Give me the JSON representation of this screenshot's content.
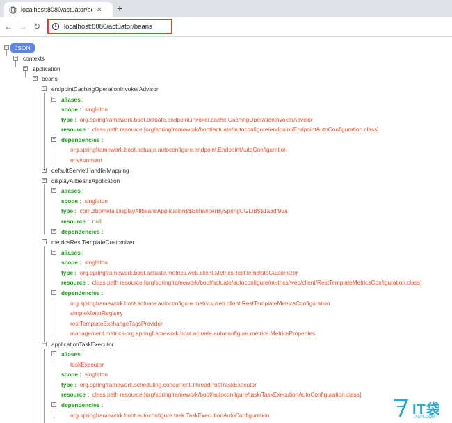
{
  "browser": {
    "tab_title": "localhost:8080/actuator/bean",
    "url": "localhost:8080/actuator/beans"
  },
  "tree": {
    "root": "JSON",
    "contexts": "contexts",
    "application": "application",
    "beans": "beans",
    "labels": {
      "aliases": "aliases :",
      "scope": "scope :",
      "type": "type :",
      "resource": "resource :",
      "dependencies": "dependencies :"
    },
    "bean_list": [
      {
        "name": "endpointCachingOperationInvokerAdvisor",
        "scope": "singleton",
        "type": "org.springframework.boot.actuate.endpoint.invoker.cache.CachingOperationInvokerAdvisor",
        "resource": "class path resource [org/springframework/boot/actuate/autoconfigure/endpoint/EndpointAutoConfiguration.class]",
        "dependencies": [
          "org.springframework.boot.actuate.autoconfigure.endpoint.EndpointAutoConfiguration",
          "environment"
        ]
      },
      {
        "name": "defaultServletHandlerMapping"
      },
      {
        "name": "displayAllbeansApplication",
        "scope": "singleton",
        "type": "com.zbbmeta.DisplayAllbeansApplication$$EnhancerBySpringCGLIB$$1a3df95a",
        "resource": "null"
      },
      {
        "name": "metricsRestTemplateCustomizer",
        "scope": "singleton",
        "type": "org.springframework.boot.actuate.metrics.web.client.MetricsRestTemplateCustomizer",
        "resource": "class path resource [org/springframework/boot/actuate/autoconfigure/metrics/web/client/RestTemplateMetricsConfiguration.class]",
        "dependencies": [
          "org.springframework.boot.actuate.autoconfigure.metrics.web.client.RestTemplateMetricsConfiguration",
          "simpleMeterRegistry",
          "restTemplateExchangeTagsProvider",
          "management.metrics-org.springframework.boot.actuate.autoconfigure.metrics.MetricsProperties"
        ]
      },
      {
        "name": "applicationTaskExecutor",
        "aliases": [
          "taskExecutor"
        ],
        "scope": "singleton",
        "type": "org.springframework.scheduling.concurrent.ThreadPoolTaskExecutor",
        "resource": "class path resource [org/springframework/boot/autoconfigure/task/TaskExecutionAutoConfiguration.class]",
        "dependencies": [
          "org.springframework.boot.autoconfigure.task.TaskExecutionAutoConfiguration"
        ]
      }
    ]
  },
  "watermark": {
    "big": "IT袋",
    "small": "ITDAI.COM"
  }
}
